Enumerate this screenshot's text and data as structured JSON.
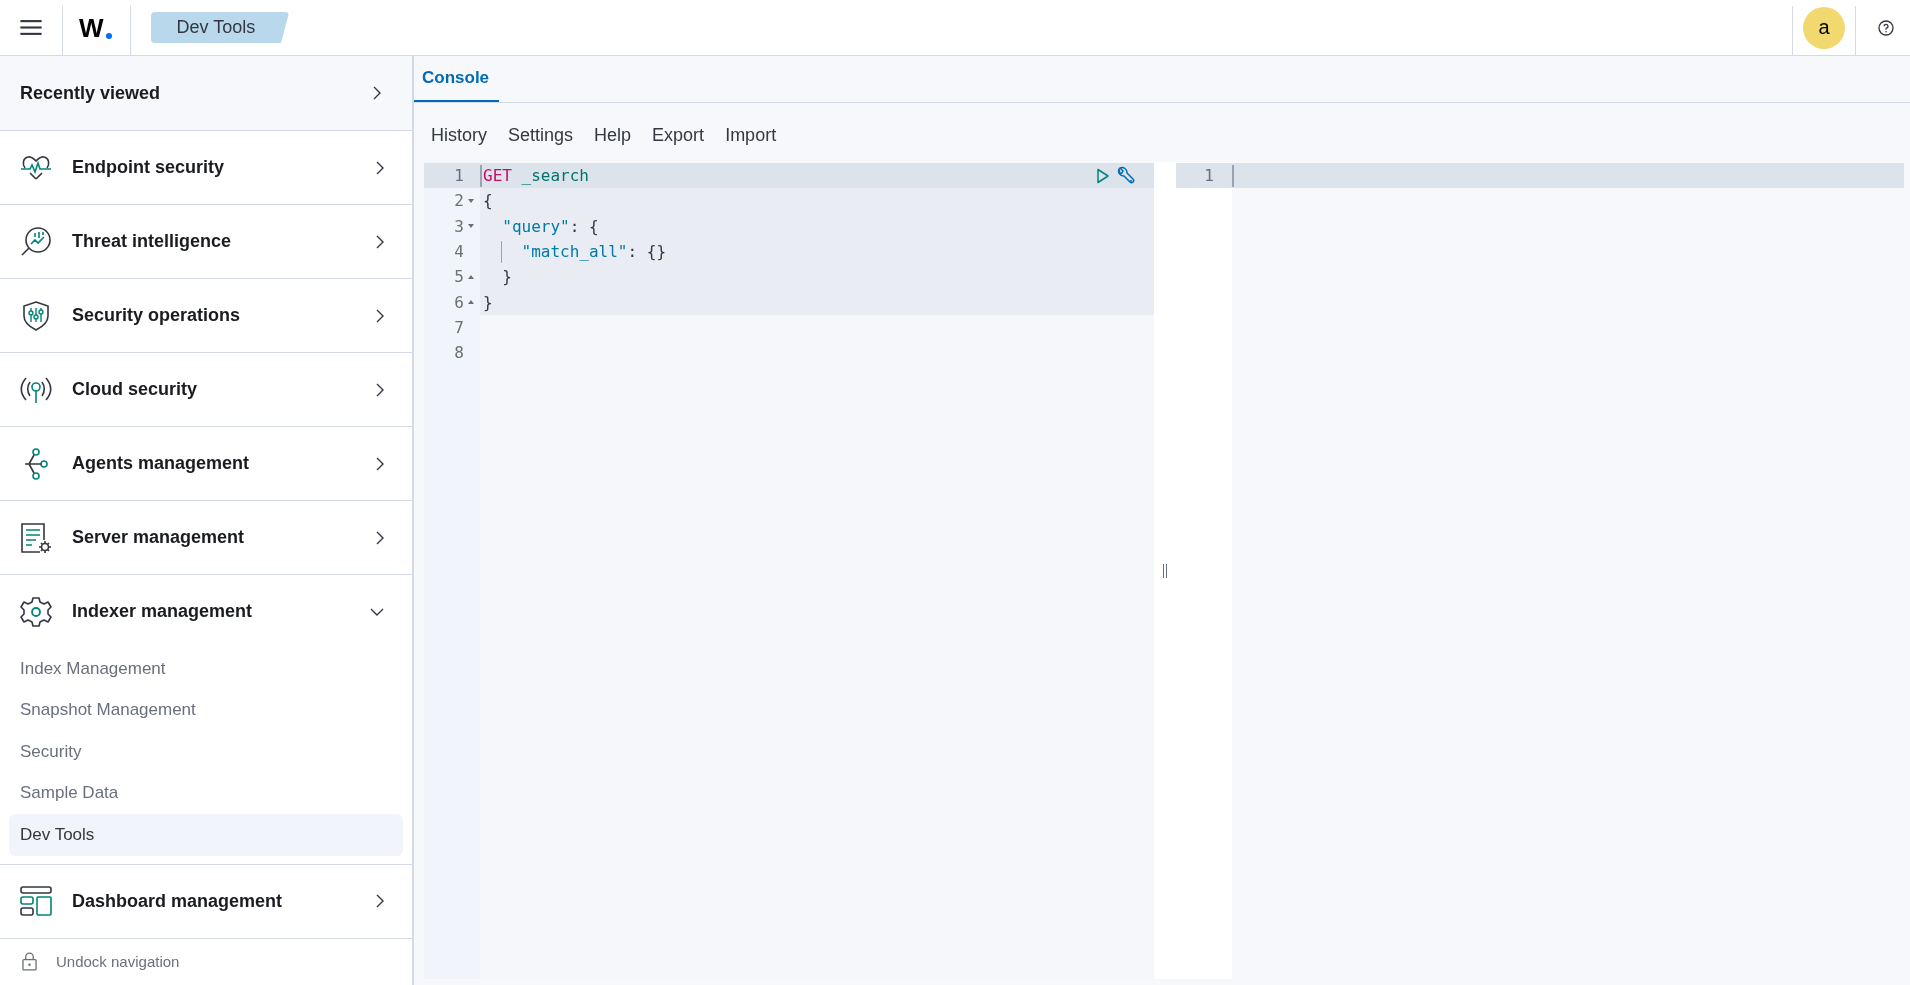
{
  "header": {
    "logo": "W",
    "breadcrumb": "Dev Tools",
    "avatar": "a"
  },
  "sidebar": {
    "recently_viewed": "Recently viewed",
    "groups": [
      {
        "label": "Endpoint security",
        "kind": "heart",
        "expanded": false
      },
      {
        "label": "Threat intelligence",
        "kind": "scope",
        "expanded": false
      },
      {
        "label": "Security operations",
        "kind": "shield",
        "expanded": false
      },
      {
        "label": "Cloud security",
        "kind": "antenna",
        "expanded": false
      },
      {
        "label": "Agents management",
        "kind": "nodes",
        "expanded": false
      },
      {
        "label": "Server management",
        "kind": "document",
        "expanded": false
      },
      {
        "label": "Indexer management",
        "kind": "gear",
        "expanded": true,
        "children": [
          {
            "label": "Index Management",
            "selected": false
          },
          {
            "label": "Snapshot Management",
            "selected": false
          },
          {
            "label": "Security",
            "selected": false
          },
          {
            "label": "Sample Data",
            "selected": false
          },
          {
            "label": "Dev Tools",
            "selected": true
          }
        ]
      },
      {
        "label": "Dashboard management",
        "kind": "layout",
        "expanded": false
      }
    ],
    "undock": "Undock navigation"
  },
  "console": {
    "tabs": [
      {
        "label": "Console",
        "selected": true
      }
    ],
    "menu": [
      "History",
      "Settings",
      "Help",
      "Export",
      "Import"
    ],
    "request_lines": [
      {
        "number": "1",
        "active": true,
        "cursor": true,
        "in_block": true,
        "tokens": [
          {
            "kind": "method",
            "text": "GET"
          },
          {
            "kind": "path",
            "text": " _search"
          }
        ]
      },
      {
        "number": "2",
        "active": false,
        "in_block": true,
        "fold_start": true,
        "tokens": [
          {
            "kind": "punct",
            "text": "{"
          }
        ]
      },
      {
        "number": "3",
        "active": false,
        "in_block": true,
        "fold_start": true,
        "tokens": [
          {
            "kind": "key",
            "text": "  \"query\""
          },
          {
            "kind": "punct",
            "text": ": {"
          }
        ]
      },
      {
        "number": "4",
        "active": false,
        "in_block": true,
        "indent_guide": true,
        "tokens": [
          {
            "kind": "key",
            "text": "  \"match_all\""
          },
          {
            "kind": "punct",
            "text": ": {}"
          }
        ]
      },
      {
        "number": "5",
        "active": false,
        "in_block": true,
        "fold_end": true,
        "tokens": [
          {
            "kind": "punct",
            "text": "  }"
          }
        ]
      },
      {
        "number": "6",
        "active": false,
        "in_block": true,
        "fold_end": true,
        "tokens": [
          {
            "kind": "punct",
            "text": "}"
          }
        ]
      },
      {
        "number": "7",
        "active": false,
        "in_block": false
      },
      {
        "number": "8",
        "active": false,
        "in_block": false
      }
    ],
    "response_lines": [
      {
        "number": "1",
        "active": true,
        "cursor": true
      }
    ]
  }
}
